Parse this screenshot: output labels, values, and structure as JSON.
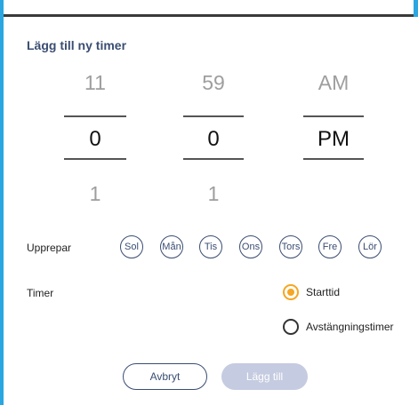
{
  "dialog": {
    "title": "Lägg till ny timer"
  },
  "picker": {
    "hours": {
      "above": "11",
      "selected": "0",
      "below": "1"
    },
    "minutes": {
      "above": "59",
      "selected": "0",
      "below": "1"
    },
    "period": {
      "above": "AM",
      "selected": "PM"
    }
  },
  "repeat": {
    "label": "Upprepar",
    "days": [
      "Sol",
      "Mån",
      "Tis",
      "Ons",
      "Tors",
      "Fre",
      "Lör"
    ]
  },
  "timer": {
    "label": "Timer",
    "options": [
      {
        "label": "Starttid",
        "selected": true
      },
      {
        "label": "Avstängningstimer",
        "selected": false
      }
    ]
  },
  "actions": {
    "cancel_label": "Avbryt",
    "add_label": "Lägg till"
  },
  "colors": {
    "accent": "#2aa6e0",
    "title": "#3a4d72",
    "radio_selected": "#f5a623",
    "button_disabled": "#c5cbe0"
  }
}
